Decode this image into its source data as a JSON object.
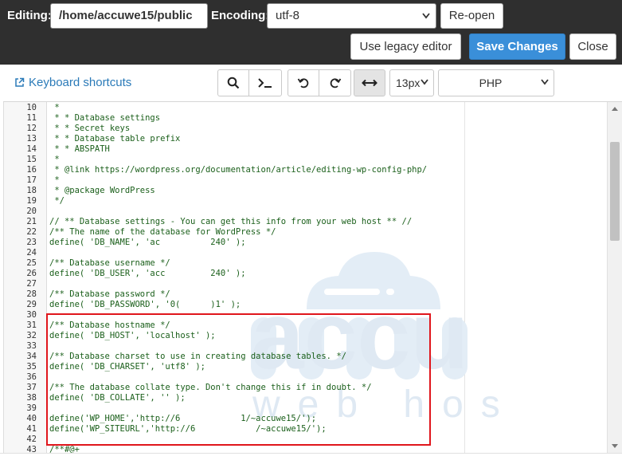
{
  "header": {
    "editing_label": "Editing:",
    "file_path": "/home/accuwe15/public",
    "encoding_label": "Encoding:",
    "encoding_value": "utf-8",
    "reopen_label": "Re-open",
    "legacy_label": "Use legacy editor",
    "save_label": "Save Changes",
    "close_label": "Close"
  },
  "toolbar": {
    "keyboard_shortcuts": "Keyboard shortcuts",
    "font_size": "13px",
    "mode": "PHP",
    "icons": [
      "search-icon",
      "terminal-icon",
      "undo-icon",
      "redo-icon",
      "wrap-icon"
    ]
  },
  "watermark": {
    "line1": "accu",
    "line2": "web hosting"
  },
  "colors": {
    "accent": "#3a8fd9",
    "highlight": "#e0161c",
    "code": "#1a5f1a",
    "topbar": "#2f2f2f"
  },
  "lines": [
    {
      "n": "10",
      "t": " *"
    },
    {
      "n": "11",
      "t": " * * Database settings"
    },
    {
      "n": "12",
      "t": " * * Secret keys"
    },
    {
      "n": "13",
      "t": " * * Database table prefix"
    },
    {
      "n": "14",
      "t": " * * ABSPATH"
    },
    {
      "n": "15",
      "t": " *"
    },
    {
      "n": "16",
      "t": " * @link https://wordpress.org/documentation/article/editing-wp-config-php/"
    },
    {
      "n": "17",
      "t": " *"
    },
    {
      "n": "18",
      "t": " * @package WordPress"
    },
    {
      "n": "19",
      "t": " */"
    },
    {
      "n": "20",
      "t": ""
    },
    {
      "n": "21",
      "t": "// ** Database settings - You can get this info from your web host ** //"
    },
    {
      "n": "22",
      "t": "/** The name of the database for WordPress */"
    },
    {
      "n": "23",
      "t": "define( 'DB_NAME', 'ac          240' );"
    },
    {
      "n": "24",
      "t": ""
    },
    {
      "n": "25",
      "t": "/** Database username */"
    },
    {
      "n": "26",
      "t": "define( 'DB_USER', 'acc         240' );"
    },
    {
      "n": "27",
      "t": ""
    },
    {
      "n": "28",
      "t": "/** Database password */"
    },
    {
      "n": "29",
      "t": "define( 'DB_PASSWORD', '0(      )1' );"
    },
    {
      "n": "30",
      "t": ""
    },
    {
      "n": "31",
      "t": "/** Database hostname */"
    },
    {
      "n": "32",
      "t": "define( 'DB_HOST', 'localhost' );"
    },
    {
      "n": "33",
      "t": ""
    },
    {
      "n": "34",
      "t": "/** Database charset to use in creating database tables. */"
    },
    {
      "n": "35",
      "t": "define( 'DB_CHARSET', 'utf8' );"
    },
    {
      "n": "36",
      "t": ""
    },
    {
      "n": "37",
      "t": "/** The database collate type. Don't change this if in doubt. */"
    },
    {
      "n": "38",
      "t": "define( 'DB_COLLATE', '' );"
    },
    {
      "n": "39",
      "t": ""
    },
    {
      "n": "40",
      "t": "define('WP_HOME','http://6            1/~accuwe15/');"
    },
    {
      "n": "41",
      "t": "define('WP_SITEURL','http://6            /~accuwe15/');"
    },
    {
      "n": "42",
      "t": ""
    },
    {
      "n": "43",
      "t": "/**#@+"
    }
  ]
}
